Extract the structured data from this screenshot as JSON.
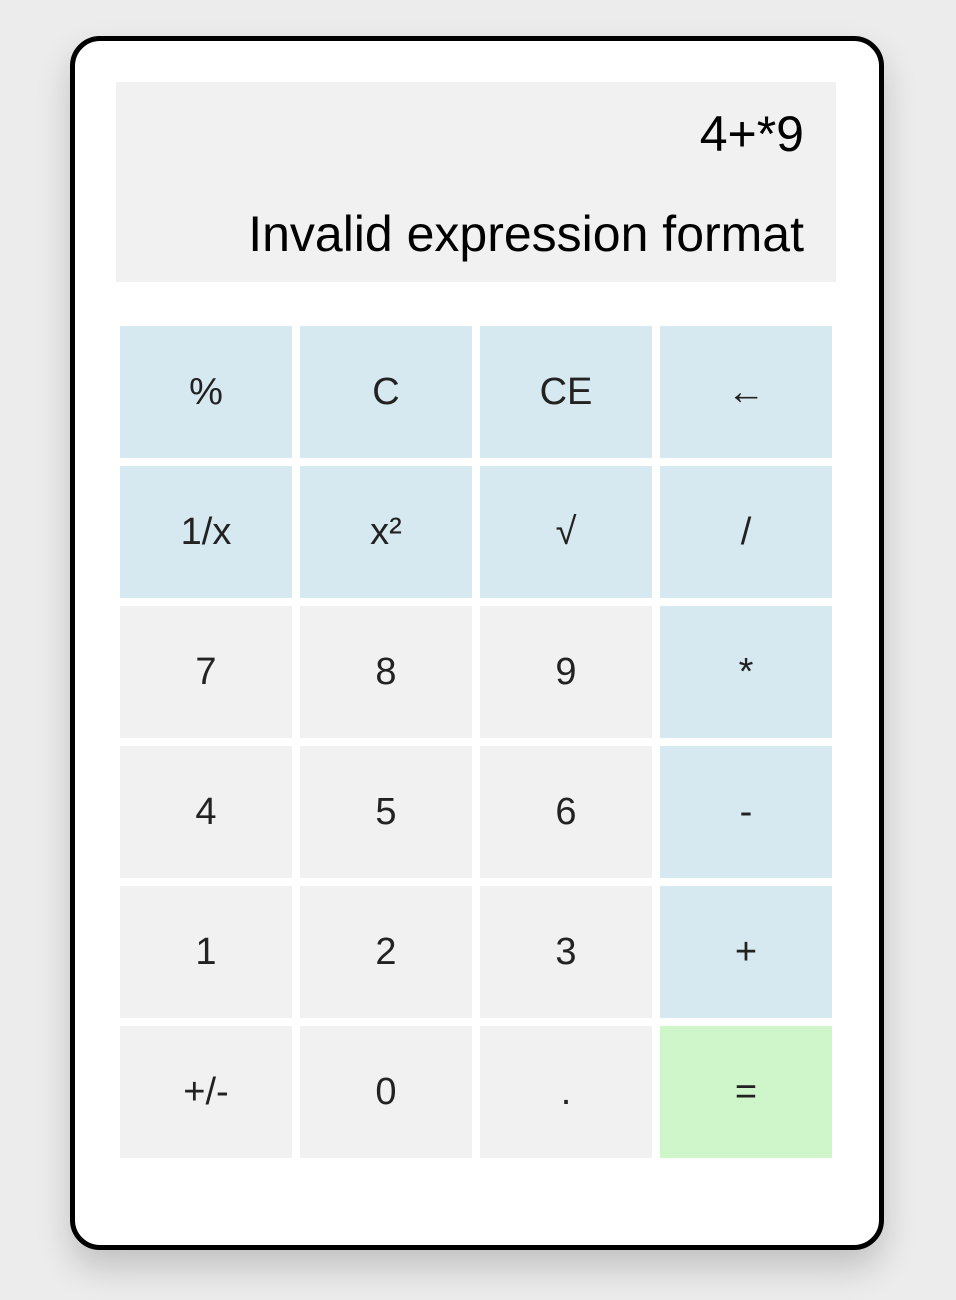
{
  "display": {
    "expression": "4+*9",
    "result": "Invalid expression format"
  },
  "keys": [
    {
      "label": "%",
      "name": "percent-key",
      "kind": "op"
    },
    {
      "label": "C",
      "name": "clear-key",
      "kind": "op"
    },
    {
      "label": "CE",
      "name": "clear-entry-key",
      "kind": "op"
    },
    {
      "label": "←",
      "name": "backspace-key",
      "kind": "op"
    },
    {
      "label": "1/x",
      "name": "reciprocal-key",
      "kind": "op"
    },
    {
      "label": "x²",
      "name": "square-key",
      "kind": "op"
    },
    {
      "label": "√",
      "name": "square-root-key",
      "kind": "op"
    },
    {
      "label": "/",
      "name": "divide-key",
      "kind": "op"
    },
    {
      "label": "7",
      "name": "digit-7-key",
      "kind": "num"
    },
    {
      "label": "8",
      "name": "digit-8-key",
      "kind": "num"
    },
    {
      "label": "9",
      "name": "digit-9-key",
      "kind": "num"
    },
    {
      "label": "*",
      "name": "multiply-key",
      "kind": "op"
    },
    {
      "label": "4",
      "name": "digit-4-key",
      "kind": "num"
    },
    {
      "label": "5",
      "name": "digit-5-key",
      "kind": "num"
    },
    {
      "label": "6",
      "name": "digit-6-key",
      "kind": "num"
    },
    {
      "label": "-",
      "name": "subtract-key",
      "kind": "op"
    },
    {
      "label": "1",
      "name": "digit-1-key",
      "kind": "num"
    },
    {
      "label": "2",
      "name": "digit-2-key",
      "kind": "num"
    },
    {
      "label": "3",
      "name": "digit-3-key",
      "kind": "num"
    },
    {
      "label": "+",
      "name": "add-key",
      "kind": "op"
    },
    {
      "label": "+/-",
      "name": "negate-key",
      "kind": "num"
    },
    {
      "label": "0",
      "name": "digit-0-key",
      "kind": "num"
    },
    {
      "label": ".",
      "name": "decimal-key",
      "kind": "num"
    },
    {
      "label": "=",
      "name": "equals-key",
      "kind": "eq"
    }
  ],
  "colors": {
    "number_key": "#f1f1f1",
    "operator_key": "#d7e9f0",
    "equals_key": "#cff5cb",
    "display_background": "#f1f1f1"
  }
}
